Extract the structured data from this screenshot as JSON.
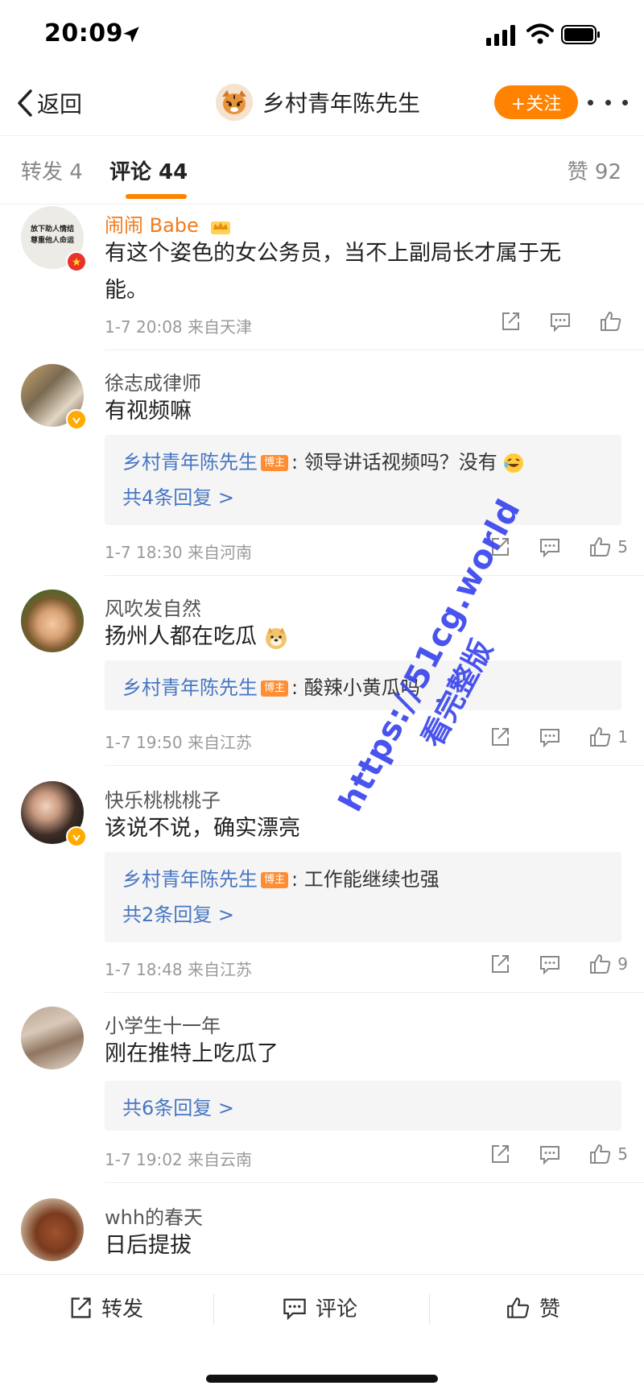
{
  "status_bar": {
    "time": "20:09"
  },
  "nav": {
    "back_label": "返回",
    "title": "乡村青年陈先生",
    "follow_label": "+关注"
  },
  "tabs": {
    "repost": "转发 4",
    "comment": "评论 44",
    "like": "赞 92"
  },
  "comments": [
    {
      "name": "闹闹 Babe",
      "avatar_text_1": "放下助人情结",
      "avatar_text_2": "尊重他人命运",
      "text_line1": "有这个姿色的女公务员，当不上副局长才属于无",
      "text_line2": "能。",
      "meta": "1-7 20:08  来自天津",
      "likes": ""
    },
    {
      "name": "徐志成律师",
      "text": "有视频嘛",
      "reply_author": "乡村青年陈先生",
      "host_tag": "博主",
      "reply_text": ": 领导讲话视频吗？没有",
      "reply_more": "共4条回复 >",
      "meta": "1-7 18:30  来自河南",
      "likes": "5"
    },
    {
      "name": "风吹发自然",
      "text": "扬州人都在吃瓜",
      "reply_author": "乡村青年陈先生",
      "host_tag": "博主",
      "reply_text": ": 酸辣小黄瓜吗",
      "meta": "1-7 19:50  来自江苏",
      "likes": "1"
    },
    {
      "name": "快乐桃桃桃子",
      "text": "该说不说，确实漂亮",
      "reply_author": "乡村青年陈先生",
      "host_tag": "博主",
      "reply_text": ": 工作能继续也强",
      "reply_more": "共2条回复 >",
      "meta": "1-7 18:48  来自江苏",
      "likes": "9"
    },
    {
      "name": "小学生十一年",
      "text": "刚在推特上吃瓜了",
      "reply_more": "共6条回复 >",
      "meta": "1-7 19:02  来自云南",
      "likes": "5"
    },
    {
      "name": "whh的春天",
      "text": "日后提拔"
    }
  ],
  "bottom_bar": {
    "repost": "转发",
    "comment": "评论",
    "like": "赞"
  },
  "watermark": {
    "line1": "https://51cg.world",
    "line2": "看完整版"
  },
  "colors": {
    "accent": "#ff8200",
    "link": "#4876c2",
    "vip_name": "#f07b1d",
    "watermark": "#3a46ee"
  }
}
